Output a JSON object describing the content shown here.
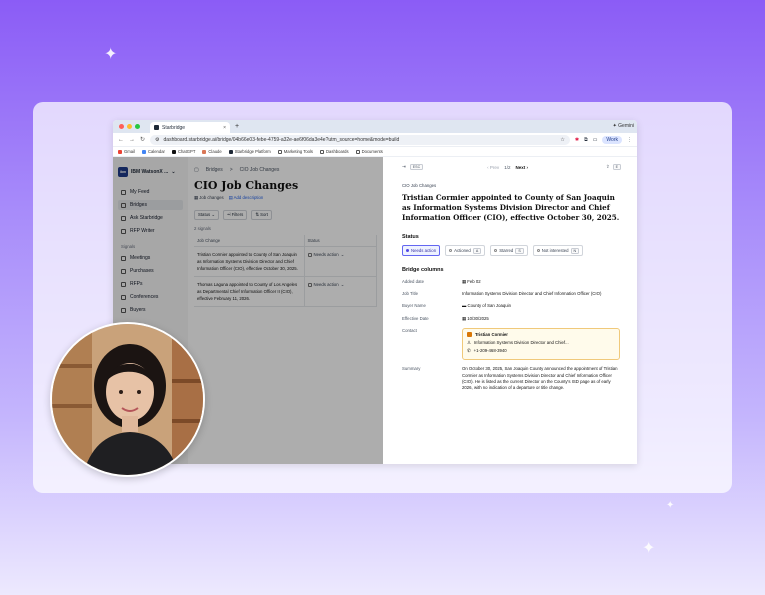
{
  "browser": {
    "tab_title": "Starbridge",
    "profile_tab": "Gemini",
    "url": "dashboard.starbridge.ai/bridge/04b66e03-febe-4759-a32e-ae6f06da3e4e?utm_source=home&mode=build",
    "profile": "Work",
    "bookmarks": [
      "Gmail",
      "Calendar",
      "ChatGPT",
      "Claude",
      "Starbridge Platform",
      "Marketing Tools",
      "Dashboards",
      "Documents"
    ]
  },
  "sidebar": {
    "workspace": "IBM WatsonX ...",
    "workspace_badge": "ibm",
    "items": [
      {
        "label": "My Feed"
      },
      {
        "label": "Bridges"
      },
      {
        "label": "Ask Starbridge"
      },
      {
        "label": "RFP Writer"
      }
    ],
    "signals_label": "Signals",
    "signals": [
      {
        "label": "Meetings"
      },
      {
        "label": "Purchases"
      },
      {
        "label": "RFPs"
      },
      {
        "label": "Conferences"
      },
      {
        "label": "Buyers"
      }
    ]
  },
  "main": {
    "breadcrumb_root": "Bridges",
    "breadcrumb_current": "CIO Job Changes",
    "title": "CIO Job Changes",
    "tag": "Job changes",
    "add_description": "Add description",
    "filters": [
      "Status",
      "Filters",
      "Sort"
    ],
    "count": "2 signals",
    "columns": [
      "Job Change",
      "Status"
    ],
    "rows": [
      {
        "job_change": "Tristian Cormier appointed to County of San Joaquin as Information Systems Division Director and Chief Information Officer (CIO), effective October 30, 2025.",
        "status": "Needs action"
      },
      {
        "job_change": "Thomas Laguna appointed to County of Los Angeles as Departmental Chief Information Officer II (CIO), effective February 11, 2026.",
        "status": "Needs action"
      }
    ]
  },
  "detail": {
    "esc": "ESC",
    "prev": "Prev",
    "page": "1/2",
    "next": "Next",
    "breadcrumb": "CIO Job Changes",
    "title": "Tristian Cormier appointed to County of San Joaquin as Information Systems Division Director and Chief Information Officer (CIO), effective October 30, 2025.",
    "status_heading": "Status",
    "status_options": [
      {
        "label": "Needs action",
        "key": "A"
      },
      {
        "label": "Actioned",
        "key": "A"
      },
      {
        "label": "Starred",
        "key": "S"
      },
      {
        "label": "Not interested",
        "key": "N"
      }
    ],
    "columns_heading": "Bridge columns",
    "added_date_label": "Added date",
    "added_date": "Feb 02",
    "job_title_label": "Job Title",
    "job_title": "Information Systems Division Director and Chief Information Officer (CIO)",
    "buyer_name_label": "Buyer Name",
    "buyer_name": "County of San Joaquin",
    "effective_date_label": "Effective Date",
    "effective_date": "10/30/2025",
    "contact_label": "Contact",
    "contact_name": "Tristian Cormier",
    "contact_title": "Information Systems Division Director and Chief...",
    "contact_phone": "+1-209-468-3940",
    "summary_label": "Summary",
    "summary": "On October 30, 2025, San Joaquin County announced the appointment of Tristian Cormier as Information Systems Division Director and Chief Information Officer (CIO). He is listed as the current Director on the County's ISD page as of early 2026, with no indication of a departure or title change."
  },
  "colors": {
    "accent": "#4f46e5",
    "background_top": "#8b5cf6",
    "contact_border": "#f0c97a"
  }
}
